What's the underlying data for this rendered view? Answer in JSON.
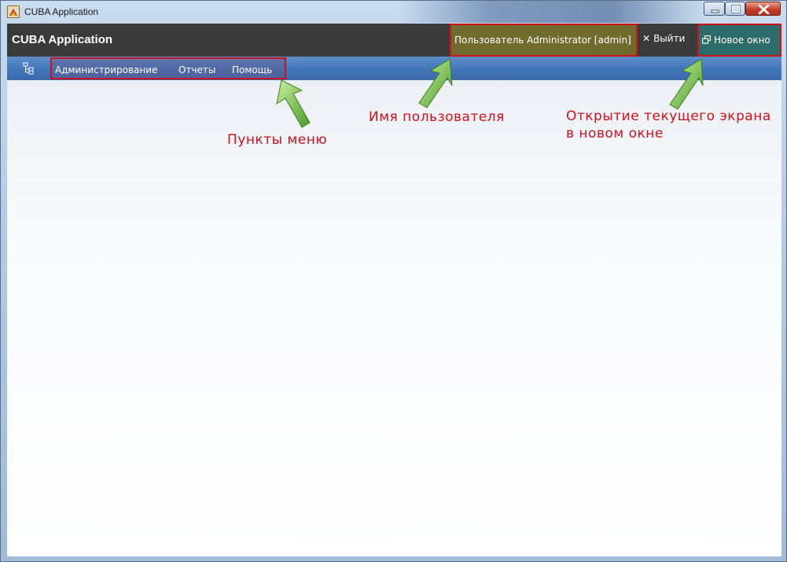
{
  "window": {
    "title": "CUBA Application",
    "controls": {
      "minimize": "minimize",
      "maximize": "maximize",
      "close": "close"
    }
  },
  "header": {
    "app_name": "CUBA Application",
    "user_label": "Пользователь Administrator [admin]",
    "logout_label": "Выйти",
    "new_window_label": "Новое окно"
  },
  "menu": {
    "items": [
      {
        "label": "Администрирование"
      },
      {
        "label": "Отчеты"
      },
      {
        "label": "Помощь"
      }
    ]
  },
  "annotations": {
    "menu_items": "Пункты меню",
    "user_name": "Имя пользователя",
    "new_window_line1": "Открытие текущего экрана",
    "new_window_line2": "в новом окне"
  },
  "colors": {
    "annotation_red": "#d0101a",
    "appbar": "#3a3a3a",
    "user_box": "#6f6b2d",
    "new_window_box": "#2d6b6a",
    "menubar": "#4176b8",
    "arrow_green": "#6fbf3a"
  }
}
